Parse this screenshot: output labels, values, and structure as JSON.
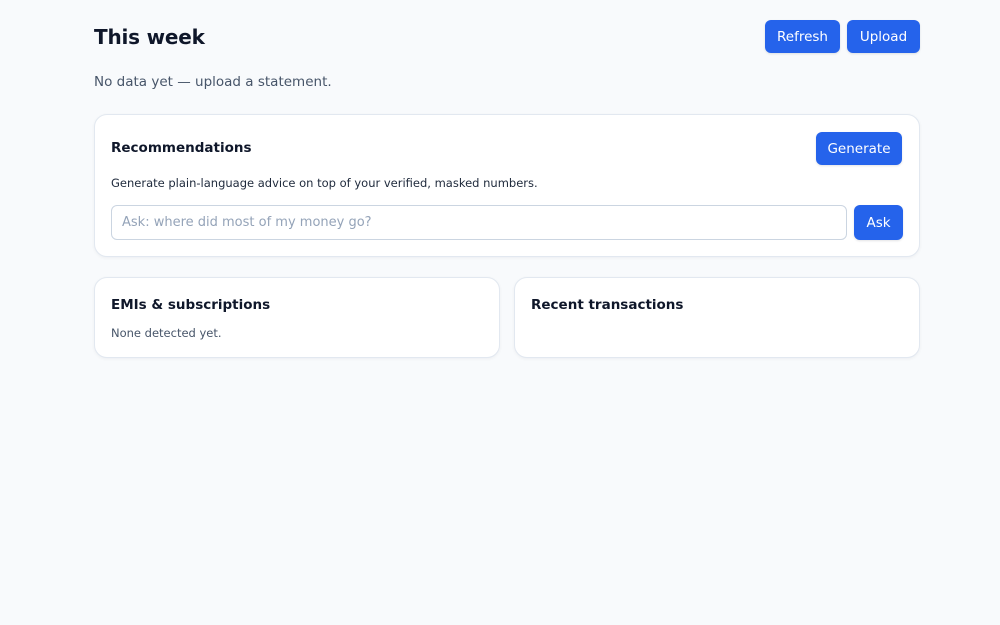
{
  "header": {
    "title": "This week",
    "refresh_label": "Refresh",
    "upload_label": "Upload"
  },
  "status": {
    "message": "No data yet — upload a statement."
  },
  "recommendations": {
    "title": "Recommendations",
    "generate_label": "Generate",
    "description": "Generate plain-language advice on top of your verified, masked numbers.",
    "ask_placeholder": "Ask: where did most of my money go?",
    "ask_value": "",
    "ask_label": "Ask"
  },
  "emis": {
    "title": "EMIs & subscriptions",
    "empty_text": "None detected yet."
  },
  "transactions": {
    "title": "Recent transactions"
  },
  "colors": {
    "accent": "#2563eb",
    "background": "#f8fafc",
    "card": "#ffffff"
  }
}
